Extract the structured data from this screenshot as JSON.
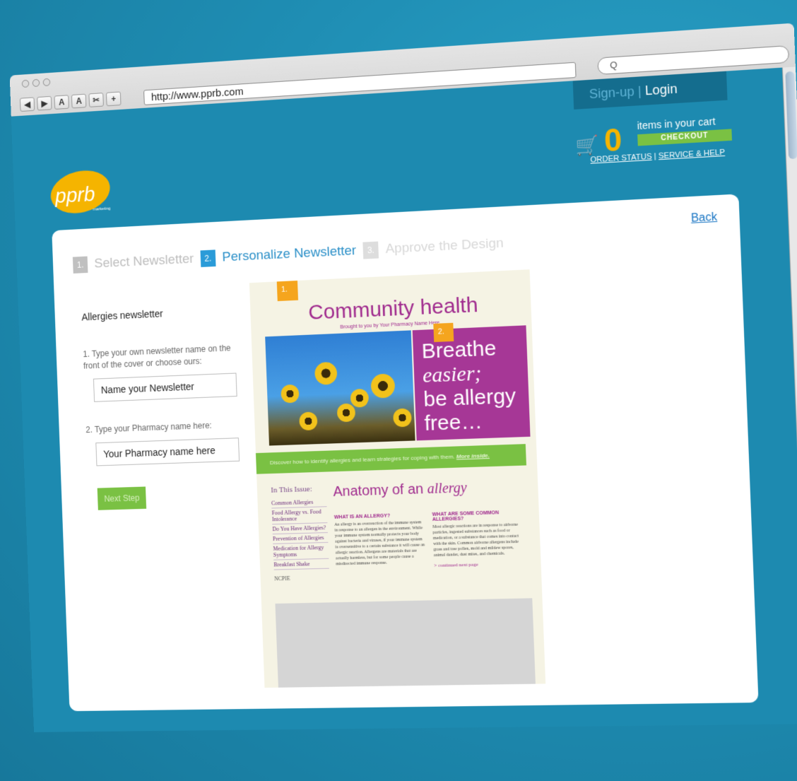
{
  "browser": {
    "url": "http://www.pprb.com",
    "search_placeholder": "Q",
    "nav_buttons": [
      "◀",
      "▶",
      "A",
      "A",
      "✂",
      "+"
    ],
    "bookmark_icon": "book-icon"
  },
  "header": {
    "signup": "Sign-up",
    "separator": "|",
    "login": "Login",
    "cart_count": "0",
    "cart_text": "items in your cart",
    "checkout": "CHECKOUT",
    "order_status": "ORDER STATUS",
    "service_help": "SERVICE & HELP",
    "link_sep": "|"
  },
  "logo": {
    "text": "pprb",
    "sub": "marketing"
  },
  "steps": [
    {
      "num": "1.",
      "label": "Select Newsletter"
    },
    {
      "num": "2.",
      "label": "Personalize Newsletter"
    },
    {
      "num": "3.",
      "label": "Approve the Design"
    }
  ],
  "back": "Back",
  "form": {
    "newsletter_title": "Allergies newsletter",
    "q1": "1. Type your own newsletter name on the front of the cover or choose ours:",
    "input1": "Name your Newsletter",
    "q2": "2. Type your Pharmacy name here:",
    "input2": "Your Pharmacy name here",
    "next": "Next Step"
  },
  "preview": {
    "badge1": "1.",
    "badge2": "2.",
    "title": "Community health",
    "byline": "Brought to you by Your Pharmacy Name Here",
    "headline_1": "Breathe",
    "headline_2": "easier;",
    "headline_3": "be allergy",
    "headline_4": "free…",
    "banner": "Discover how to identify allergies and learn strategies for coping with them.",
    "banner_link": "More inside.",
    "issue_heading": "In This Issue:",
    "issue_items": [
      "Common Allergies",
      "Food Allergy vs. Food Intolerance",
      "Do You Have Allergies?",
      "Prevention of Allergies",
      "Medication for Allergy Symptoms",
      "Breakfast Shake"
    ],
    "anatomy_1": "Anatomy of an",
    "anatomy_2": "allergy",
    "col1_head": "WHAT IS AN ALLERGY?",
    "col1_body": "An allergy is an overreaction of the immune system in response to an allergen in the environment. While your immune system normally protects your body against bacteria and viruses, if your immune system is oversensitive to a certain substance it will cause an allergic reaction. Allergens are materials that are actually harmless, but for some people cause a misdirected immune response.",
    "col2_head": "WHAT ARE SOME COMMON ALLERGIES?",
    "col2_body": "Most allergic reactions are in response to airborne particles, ingested substances such as food or medication, or a substance that comes into contact with the skin. Common airborne allergens include grass and tree pollen, mold and mildew spores, animal dander, dust mites, and chemicals.",
    "continued": "> continued next page",
    "footer_logo": "NCPIE"
  }
}
